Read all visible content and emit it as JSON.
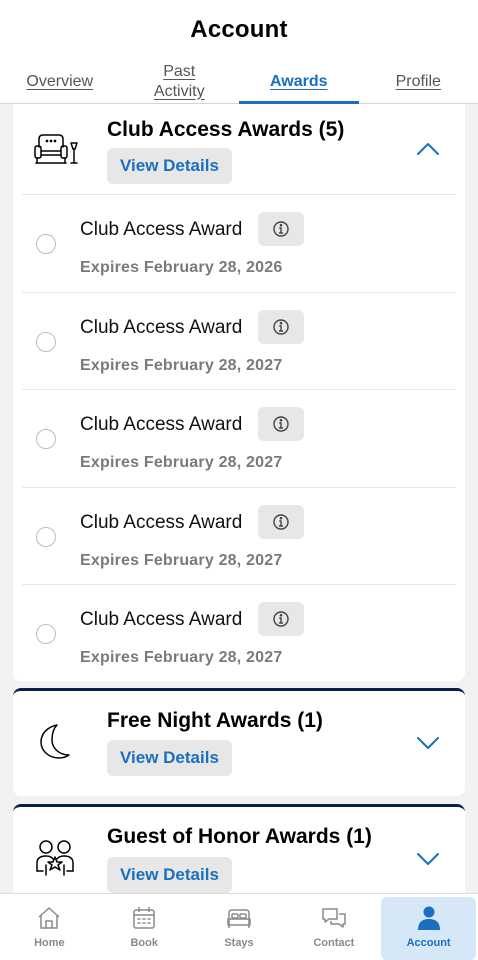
{
  "header": {
    "title": "Account"
  },
  "tabs": [
    {
      "label": "Overview",
      "active": false
    },
    {
      "label": "Past Activity",
      "active": false
    },
    {
      "label": "Awards",
      "active": true
    },
    {
      "label": "Profile",
      "active": false
    }
  ],
  "sections": [
    {
      "title": "Club Access Awards (5)",
      "button": "View Details",
      "icon": "armchair-icon",
      "expanded": true,
      "awards": [
        {
          "name": "Club Access Award",
          "expires": "Expires February 28, 2026"
        },
        {
          "name": "Club Access Award",
          "expires": "Expires February 28, 2027"
        },
        {
          "name": "Club Access Award",
          "expires": "Expires February 28, 2027"
        },
        {
          "name": "Club Access Award",
          "expires": "Expires February 28, 2027"
        },
        {
          "name": "Club Access Award",
          "expires": "Expires February 28, 2027"
        }
      ]
    },
    {
      "title": "Free Night Awards (1)",
      "button": "View Details",
      "icon": "moon-icon",
      "expanded": false
    },
    {
      "title": "Guest of Honor Awards (1)",
      "button": "View Details",
      "icon": "two-people-icon",
      "expanded": false
    }
  ],
  "nav": [
    {
      "label": "Home",
      "icon": "home-icon",
      "active": false
    },
    {
      "label": "Book",
      "icon": "calendar-icon",
      "active": false
    },
    {
      "label": "Stays",
      "icon": "bed-icon",
      "active": false
    },
    {
      "label": "Contact",
      "icon": "chat-icon",
      "active": false
    },
    {
      "label": "Account",
      "icon": "person-icon",
      "active": true
    }
  ],
  "colors": {
    "accent": "#1a6fbe",
    "navy": "#0b1f4f",
    "button_bg": "#e7e7e7",
    "active_nav_bg": "#d6e8f7"
  }
}
